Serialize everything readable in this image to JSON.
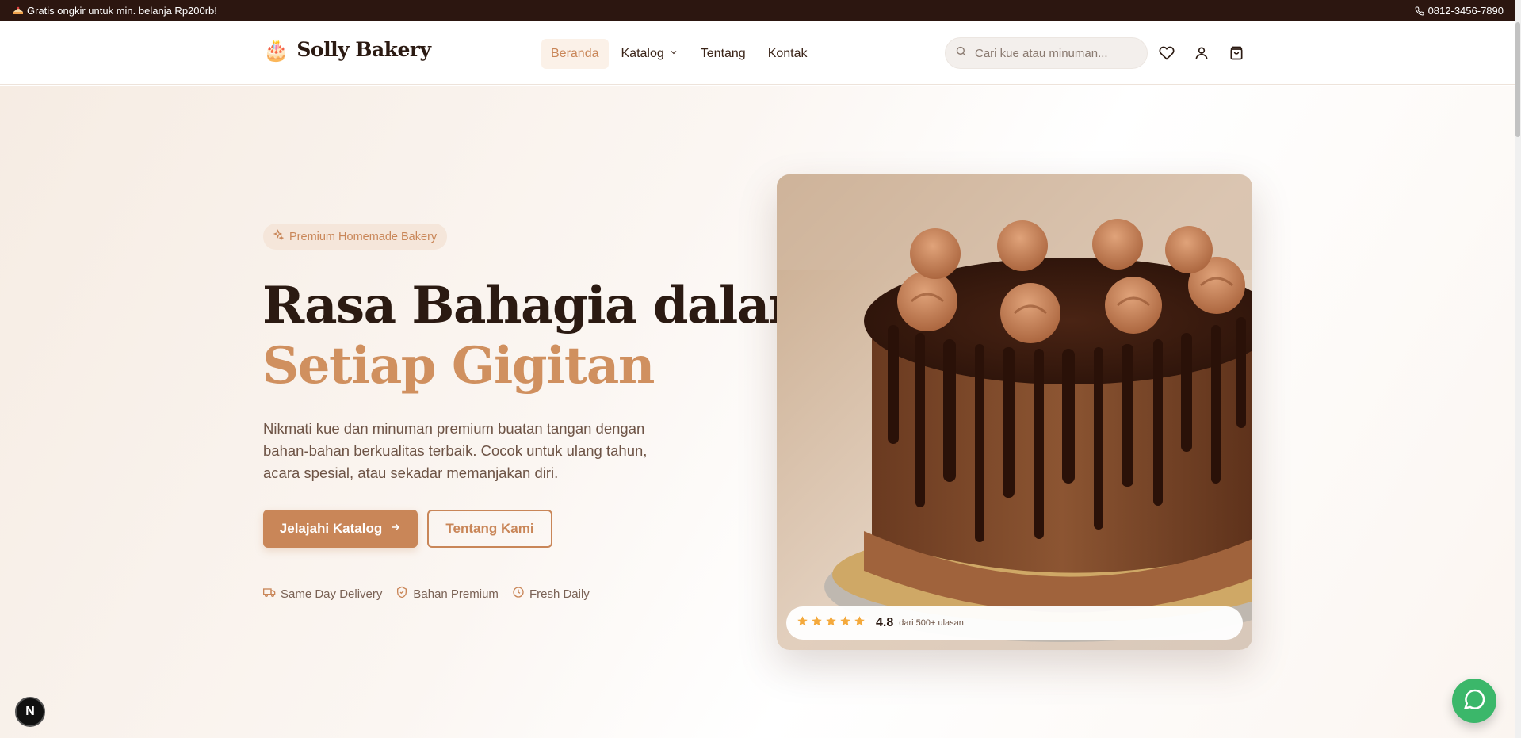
{
  "topbar": {
    "announcement_icon": "cake-slice-icon",
    "announcement": "Gratis ongkir untuk min. belanja Rp200rb!",
    "phone_icon": "phone-icon",
    "phone": "0812-3456-7890"
  },
  "navbar": {
    "logo_emoji": "🎂",
    "brand": "Solly Bakery",
    "links": [
      {
        "label": "Beranda",
        "active": true
      },
      {
        "label": "Katalog",
        "has_dropdown": true
      },
      {
        "label": "Tentang"
      },
      {
        "label": "Kontak"
      }
    ],
    "search": {
      "placeholder": "Cari kue atau minuman..."
    },
    "icons": [
      "heart-icon",
      "user-icon",
      "shopping-bag-icon"
    ]
  },
  "hero": {
    "badge": "Premium Homemade Bakery",
    "title_line1": "Rasa Bahagia dalam",
    "title_line2": "Setiap Gigitan",
    "description": "Nikmati kue dan minuman premium buatan tangan dengan bahan-bahan berkualitas terbaik. Cocok untuk ulang tahun, acara spesial, atau sekadar memanjakan diri.",
    "cta_primary": "Jelajahi Katalog",
    "cta_secondary": "Tentang Kami",
    "features": [
      {
        "icon": "truck-icon",
        "label": "Same Day Delivery"
      },
      {
        "icon": "shield-check-icon",
        "label": "Bahan Premium"
      },
      {
        "icon": "clock-icon",
        "label": "Fresh Daily"
      }
    ],
    "rating": {
      "stars": 5,
      "score": "4.8",
      "count": "dari 500+ ulasan"
    }
  },
  "floating": {
    "dev_badge": "N",
    "chat_icon": "whatsapp-chat-icon"
  },
  "colors": {
    "accent": "#c98658",
    "dark": "#2c1610",
    "chat_green": "#3bb76a"
  }
}
